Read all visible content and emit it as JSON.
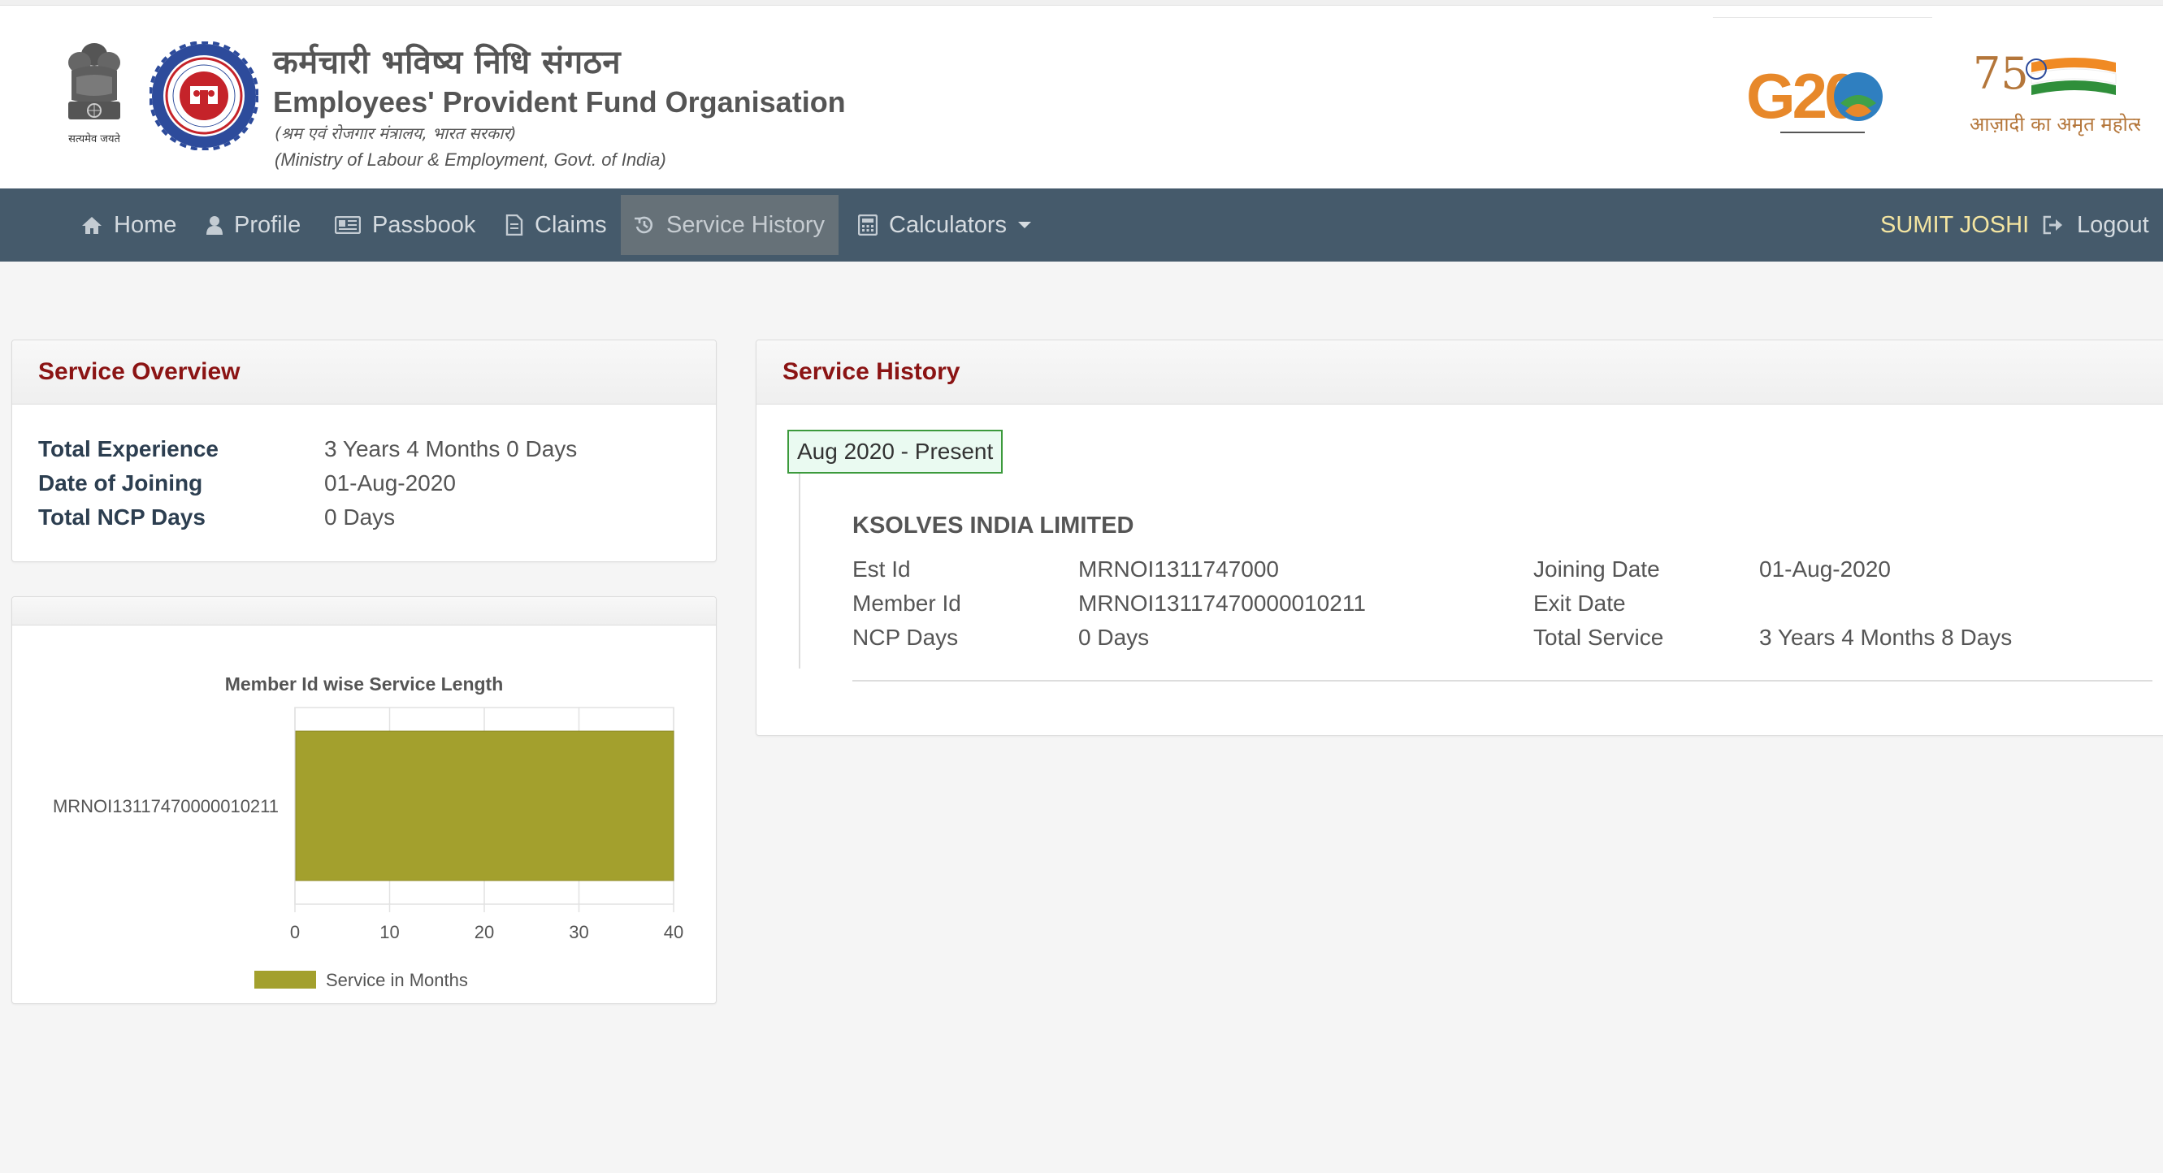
{
  "header": {
    "emblem_motto": "सत्यमेव जयते",
    "org_hindi": "कर्मचारी भविष्य निधि संगठन",
    "org_english": "Employees' Provident Fund Organisation",
    "ministry_hindi": "(श्रम एवं रोजगार मंत्रालय, भारत सरकार)",
    "ministry_english": "(Ministry of Labour & Employment, Govt. of India)",
    "g20_logo_text": "G20",
    "azadi_logo_text": "आज़ादी का अमृत महोत्सव"
  },
  "nav": {
    "items": [
      {
        "label": "Home",
        "icon": "home-icon"
      },
      {
        "label": "Profile",
        "icon": "user-icon"
      },
      {
        "label": "Passbook",
        "icon": "passbook-icon"
      },
      {
        "label": "Claims",
        "icon": "document-icon"
      },
      {
        "label": "Service History",
        "icon": "history-icon",
        "active": true
      },
      {
        "label": "Calculators",
        "icon": "calculator-icon",
        "dropdown": true
      }
    ],
    "user_name": "SUMIT JOSHI",
    "logout_label": "Logout"
  },
  "overview": {
    "title": "Service Overview",
    "rows": [
      {
        "label": "Total Experience",
        "value": "3 Years 4 Months 0 Days"
      },
      {
        "label": "Date of Joining",
        "value": "01-Aug-2020"
      },
      {
        "label": "Total NCP Days",
        "value": "0 Days"
      }
    ]
  },
  "chart_data": {
    "type": "bar",
    "orientation": "horizontal",
    "title": "Member Id wise Service Length",
    "categories": [
      "MRNOI13117470000010211"
    ],
    "series": [
      {
        "name": "Service in Months",
        "values": [
          40
        ]
      }
    ],
    "xlim": [
      0,
      40
    ],
    "x_ticks": [
      0,
      10,
      20,
      30,
      40
    ],
    "grid": true,
    "legend": "bottom",
    "bar_color": "#a3a02d"
  },
  "history": {
    "title": "Service History",
    "period": "Aug 2020 - Present",
    "company": "KSOLVES INDIA LIMITED",
    "left_rows": [
      {
        "label": "Est Id",
        "value": "MRNOI1311747000"
      },
      {
        "label": "Member Id",
        "value": "MRNOI13117470000010211"
      },
      {
        "label": "NCP Days",
        "value": "0 Days"
      }
    ],
    "right_rows": [
      {
        "label": "Joining Date",
        "value": "01-Aug-2020"
      },
      {
        "label": "Exit Date",
        "value": ""
      },
      {
        "label": "Total Service",
        "value": "3 Years 4 Months 8 Days"
      }
    ]
  },
  "colors": {
    "nav_bg": "#455a6b",
    "nav_active_bg": "#667178",
    "user_name": "#f4e5a1",
    "panel_title": "#8b1414",
    "badge_border": "#3c9a3c",
    "badge_bg": "#eafaf1"
  }
}
